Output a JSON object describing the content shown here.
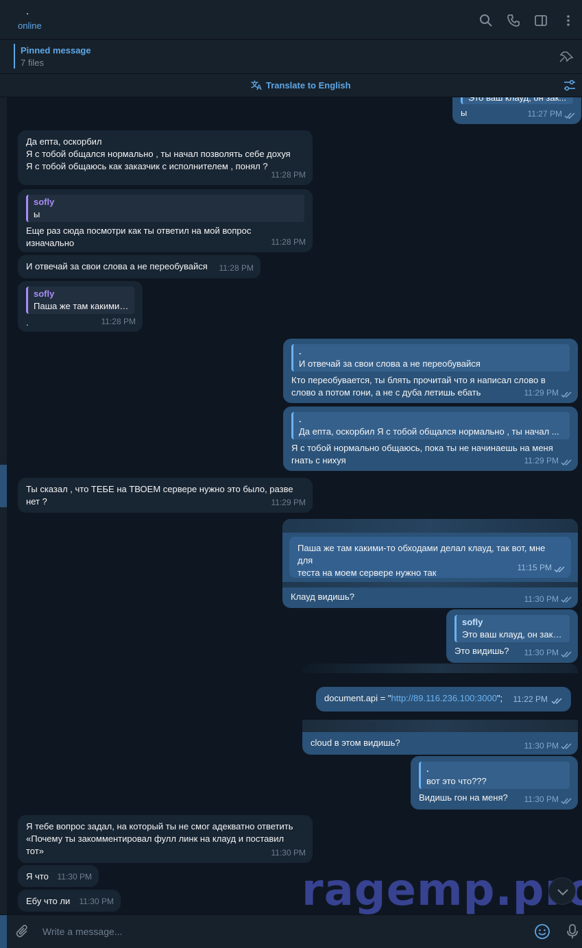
{
  "header": {
    "name": ". ",
    "status": "online"
  },
  "pinned": {
    "title": "Pinned message",
    "subtitle": "7 files"
  },
  "translate": {
    "label": "Translate to English"
  },
  "icons": [
    "search-icon",
    "phone-icon",
    "sidebar-icon",
    "more-icon",
    "unpin-icon",
    "translate-icon",
    "settings-icon",
    "attach-icon",
    "emoji-icon",
    "mic-icon",
    "double-check-icon",
    "chevron-down-icon"
  ],
  "colors": {
    "accent": "#5ea7e6",
    "out_bubble": "#2b5278",
    "in_bubble": "#182533",
    "bg": "#0e1621"
  },
  "messages": {
    "m0": {
      "quote": "Это ваш клауд, он зак...",
      "text": "ы",
      "time": "11:27 PM"
    },
    "m1": {
      "text": "Да епта, оскорбил\nЯ с тобой общался нормально , ты начал позволять себе дохуя\nЯ с тобой общаюсь как заказчик с исполнителем , понял ?",
      "time": "11:28 PM"
    },
    "m2": {
      "quote_name": "sofly",
      "quote_text": "ы",
      "text": "Еще раз сюда посмотри как ты ответил на мой вопрос\nизначально",
      "time": "11:28 PM"
    },
    "m3": {
      "text": "И отвечай за свои слова а не переобувайся",
      "time": "11:28 PM"
    },
    "m4": {
      "quote_name": "sofly",
      "quote_text": "Паша же там какими-...",
      "text": ".",
      "time": "11:28 PM"
    },
    "m5": {
      "quote_name": ".",
      "quote_text": "И отвечай за свои слова а не переобувайся",
      "text": "Кто переобувается, ты блять прочитай что я написал слово в\nслово а потом гони, а не с дуба летишь ебать",
      "time": "11:29 PM"
    },
    "m6": {
      "quote_name": ".",
      "quote_text": "Да епта, оскорбил  Я с тобой общался нормально , ты начал ...",
      "text": "Я с тобой нормально общаюсь, пока ты не начинаешь на меня\nгнать с нихуя",
      "time": "11:29 PM"
    },
    "m7": {
      "text": "Ты сказал , что ТЕБЕ на ТВОЕМ сервере нужно это было, разве\nнет ?",
      "time": "11:29 PM"
    },
    "m8": {
      "inner_text": "Паша же там какими-то обходами делал клауд, так вот, мне для\nтеста на моем сервере нужно так",
      "inner_time": "11:15 PM",
      "text": "Клауд видишь?",
      "time": "11:30 PM"
    },
    "m9": {
      "quote_name": "sofly",
      "quote_text": "Это ваш клауд, он зако...",
      "text": "Это видишь?",
      "time": "11:30 PM"
    },
    "m10": {
      "code_prefix": "document.api = \"",
      "code_link": "http://89.116.236.100:3000",
      "code_suffix": "\";",
      "inner_time": "11:22 PM",
      "text": "cloud в этом видишь?",
      "time": "11:30 PM"
    },
    "m11": {
      "quote_name": ".",
      "quote_text": "вот это что???",
      "text": "Видишь гон на меня?",
      "time": "11:30 PM"
    },
    "m12": {
      "text": "Я тебе вопрос задал, на который ты не смог адекватно ответить\n«Почему ты закомментировал фулл линк на клауд и поставил\nтот»",
      "time": "11:30 PM"
    },
    "m13": {
      "text": "Я что",
      "time": "11:30 PM"
    },
    "m14": {
      "text": "Ебу что ли",
      "time": "11:30 PM"
    }
  },
  "composer": {
    "placeholder": "Write a message..."
  },
  "watermark": "ragemp.pro"
}
